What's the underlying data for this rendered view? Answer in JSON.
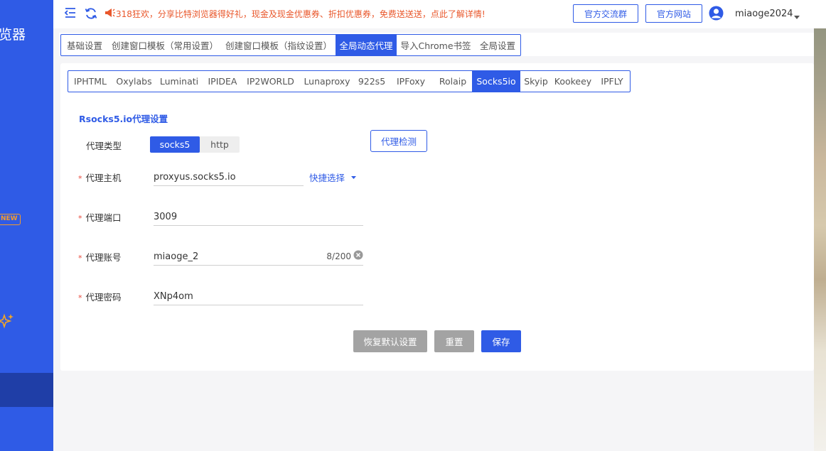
{
  "app": {
    "title_fragment": "览器",
    "new_badge": "NEW"
  },
  "header": {
    "notice": "318狂欢，分享比特浏览器得好礼，现金及现金优惠券、折扣优惠券，免费送送送，点此了解详情!",
    "buttons": {
      "community": "官方交流群",
      "website": "官方网站"
    },
    "username": "miaoge2024"
  },
  "main_tabs": [
    {
      "label": "基础设置",
      "active": false
    },
    {
      "label": "创建窗口模板（常用设置）",
      "active": false
    },
    {
      "label": "创建窗口模板（指纹设置）",
      "active": false
    },
    {
      "label": "全局动态代理",
      "active": true
    },
    {
      "label": "导入Chrome书签",
      "active": false
    },
    {
      "label": "全局设置",
      "active": false
    }
  ],
  "provider_tabs": [
    {
      "label": "IPHTML",
      "active": false
    },
    {
      "label": "Oxylabs",
      "active": false
    },
    {
      "label": "Luminati",
      "active": false
    },
    {
      "label": "IPIDEA",
      "active": false
    },
    {
      "label": "IP2WORLD",
      "active": false
    },
    {
      "label": "Lunaproxy",
      "active": false
    },
    {
      "label": "922s5",
      "active": false
    },
    {
      "label": "IPFoxy",
      "active": false
    },
    {
      "label": "Rolaip",
      "active": false
    },
    {
      "label": "Socks5io",
      "active": true
    },
    {
      "label": "Skyip",
      "active": false
    },
    {
      "label": "Kookeey",
      "active": false
    },
    {
      "label": "IPFLY",
      "active": false
    }
  ],
  "form": {
    "section_title": "Rsocks5.io代理设置",
    "proxy_type": {
      "label": "代理类型",
      "options": [
        "socks5",
        "http"
      ],
      "selected": "socks5"
    },
    "check_button": "代理检测",
    "host": {
      "label": "代理主机",
      "value": "proxyus.socks5.io",
      "quick_select": "快捷选择"
    },
    "port": {
      "label": "代理端口",
      "value": "3009"
    },
    "account": {
      "label": "代理账号",
      "value": "miaoge_2",
      "counter": "8/200"
    },
    "password": {
      "label": "代理密码",
      "value": "XNp4om"
    },
    "required_mark": "*"
  },
  "actions": {
    "restore": "恢复默认设置",
    "reset": "重置",
    "save": "保存"
  },
  "colors": {
    "primary": "#2f5be6",
    "sidebar_active": "#1f3ea7",
    "notice": "#e9572b",
    "required": "#e84a3c",
    "disabled_button": "#a3a3a3",
    "badge": "#f59b2b"
  }
}
